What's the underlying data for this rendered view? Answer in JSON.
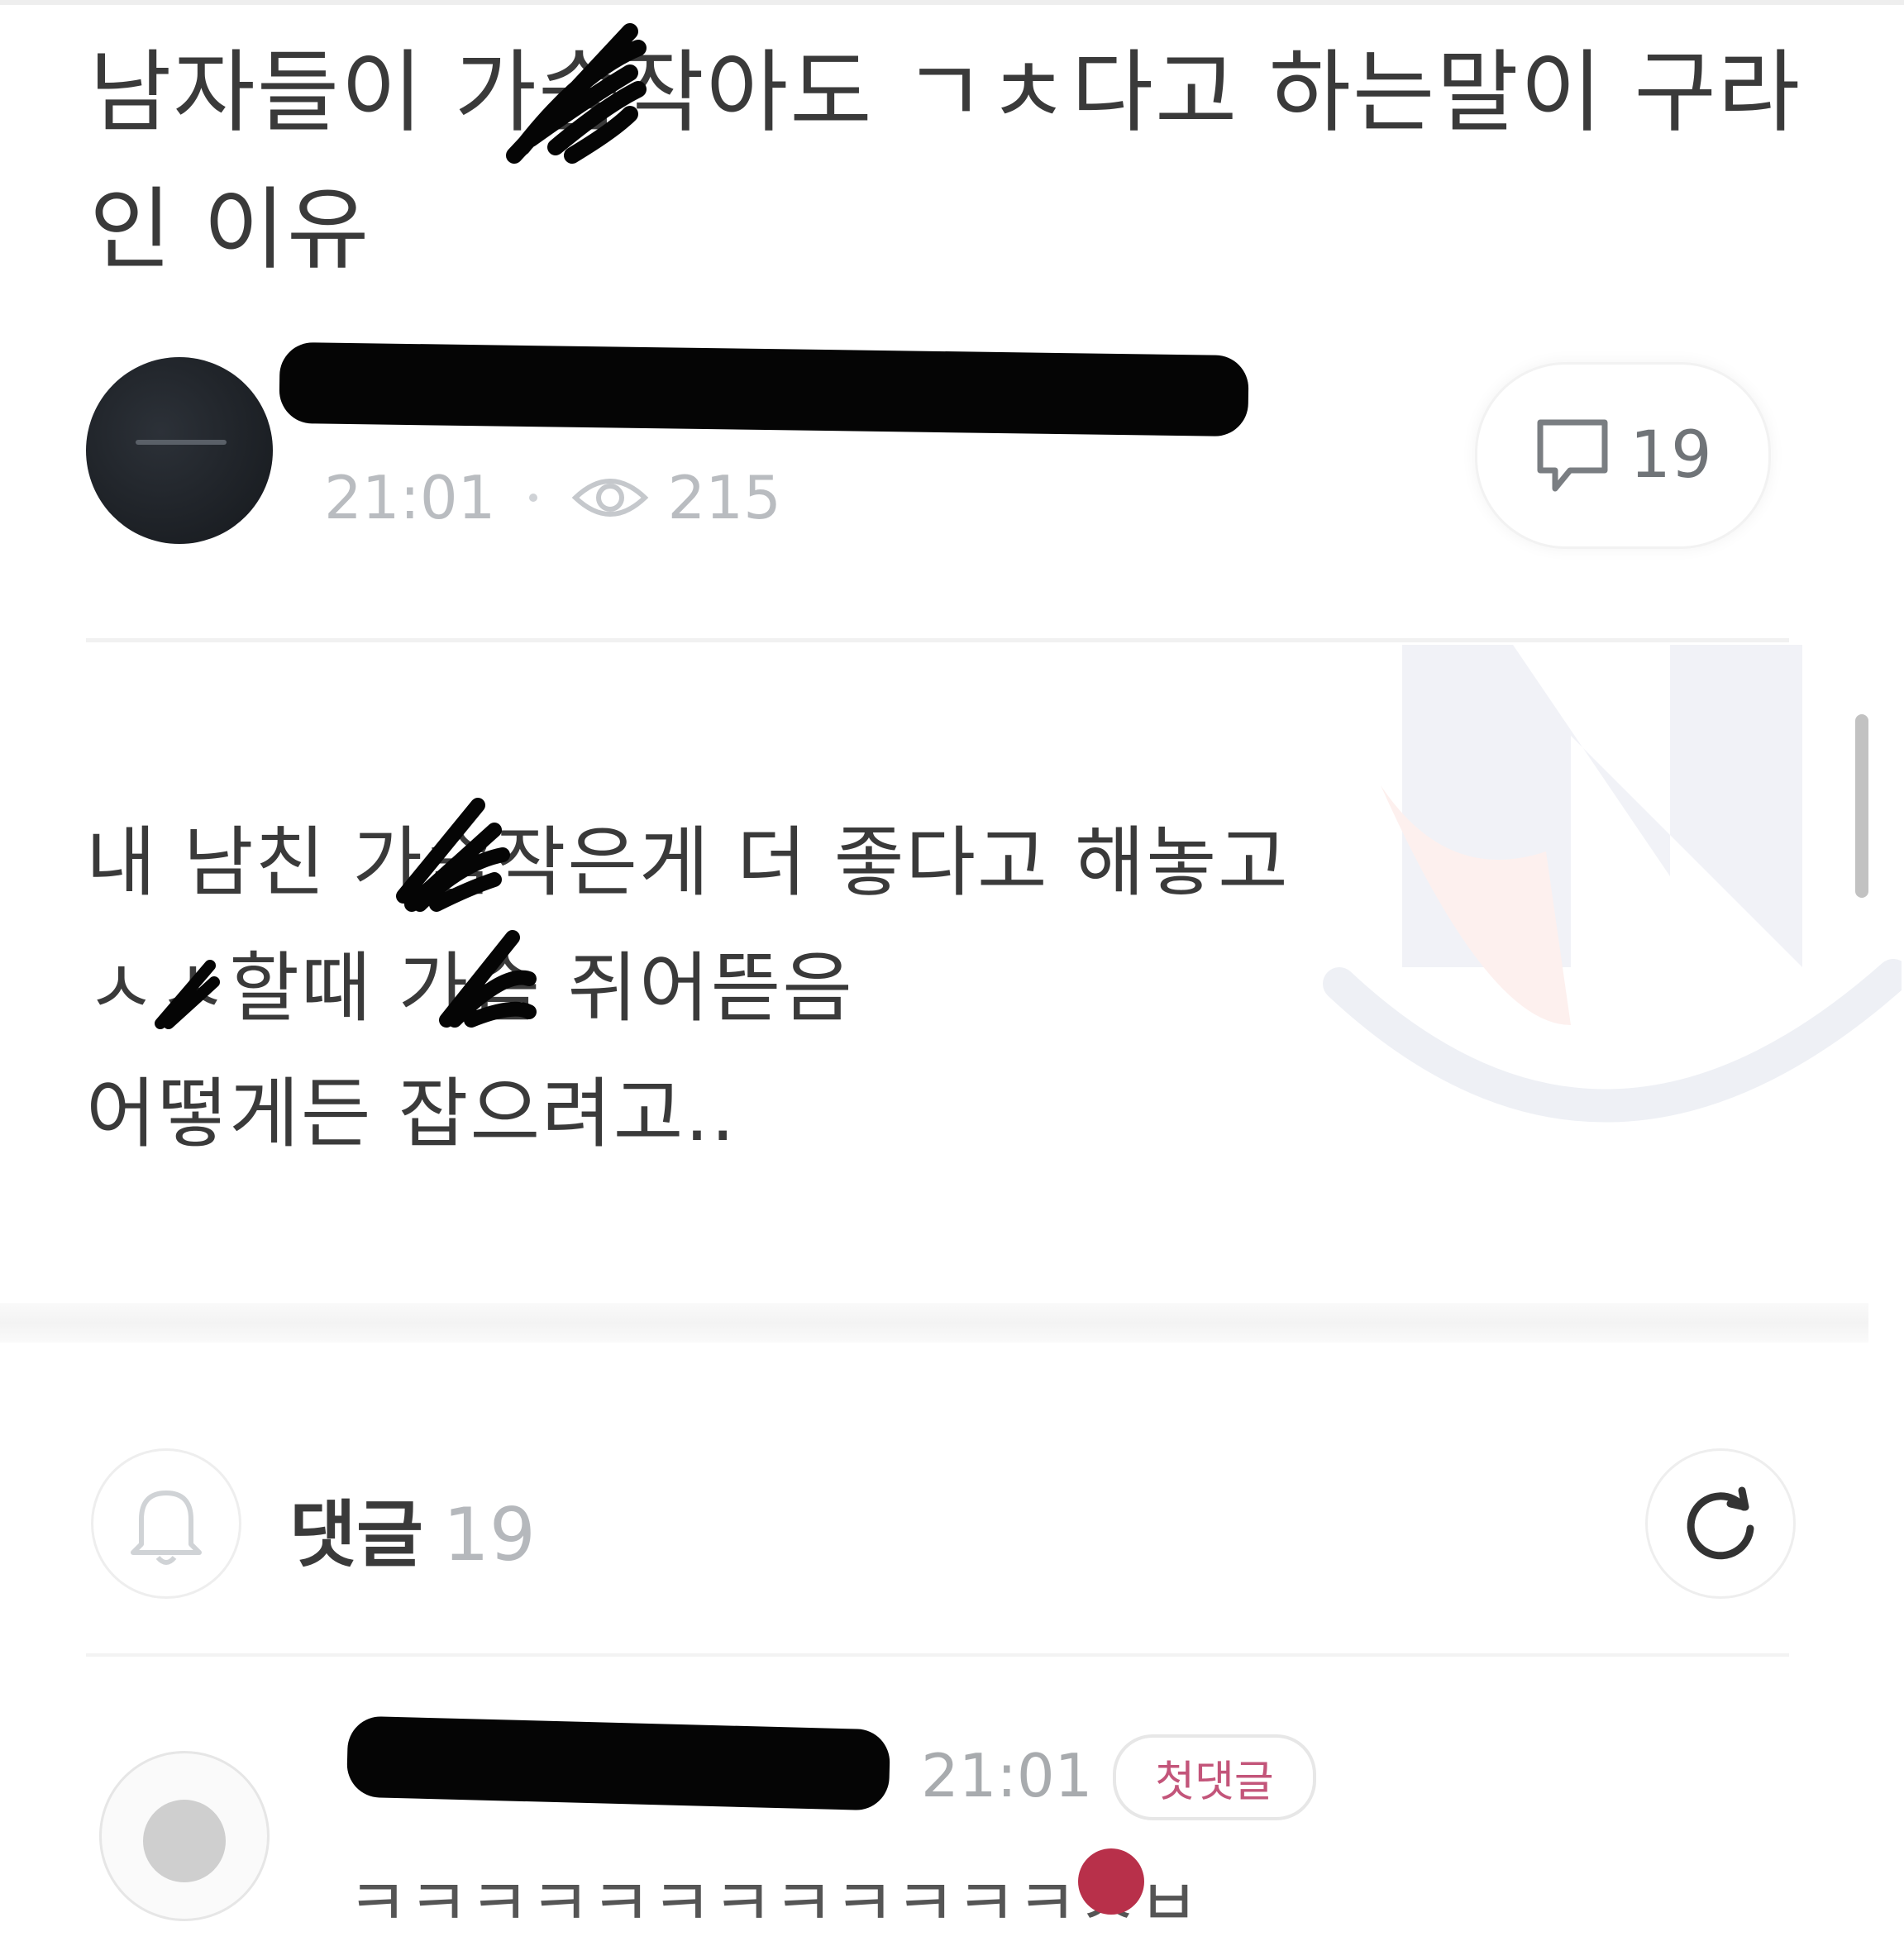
{
  "post": {
    "title": "남자들이 가슴작아도 ㄱㅊ다고 하는말이 구라인 이유",
    "author": {
      "time": "21:01",
      "views": "215"
    },
    "comment_count": "19",
    "body_lines": [
      "내 남친 가슴작은게 더 좋다고 해놓고",
      "ㅅㅅ할때 가슴 쥐어뜯음",
      "어떻게든 잡으려고.."
    ]
  },
  "comments_section": {
    "label": "댓글",
    "count": "19"
  },
  "first_comment": {
    "time": "21:01",
    "badge": "첫댓글",
    "text": "ㅋㅋㅋㅋㅋㅋㅋㅋㅋㅋㅋㅋㅅㅂ"
  },
  "colors": {
    "title": "#3a3a3a",
    "meta_gray": "#b9bcc0",
    "badge_pink": "#c3557a",
    "redaction": "#050505"
  },
  "icons": [
    "eye-icon",
    "comment-bubble-icon",
    "bell-icon",
    "refresh-icon",
    "watermark-logo"
  ]
}
